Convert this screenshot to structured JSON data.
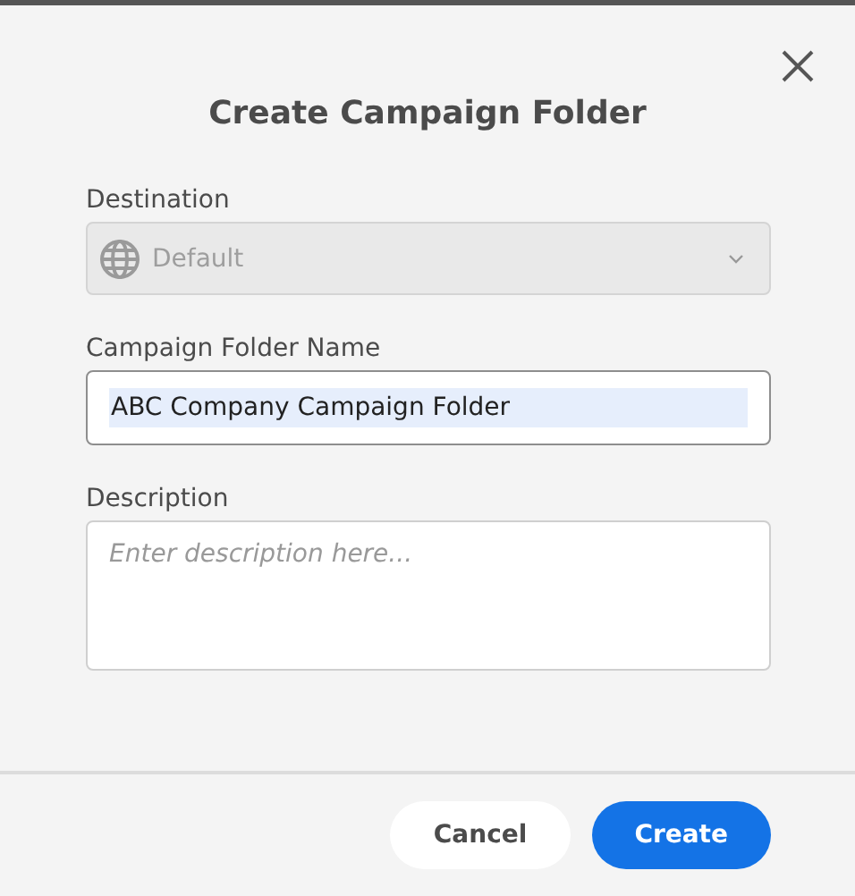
{
  "dialog": {
    "title": "Create Campaign Folder"
  },
  "fields": [
    {
      "kind": "select",
      "label": "Destination",
      "value": "Default",
      "disabled": true
    },
    {
      "kind": "text",
      "label": "Campaign Folder Name",
      "value": "ABC Company Campaign Folder",
      "value_selected": true
    },
    {
      "kind": "textarea",
      "label": "Description",
      "placeholder": "Enter description here..."
    }
  ],
  "buttons": [
    {
      "label": "Cancel",
      "kind": "secondary"
    },
    {
      "label": "Create",
      "kind": "primary"
    }
  ]
}
